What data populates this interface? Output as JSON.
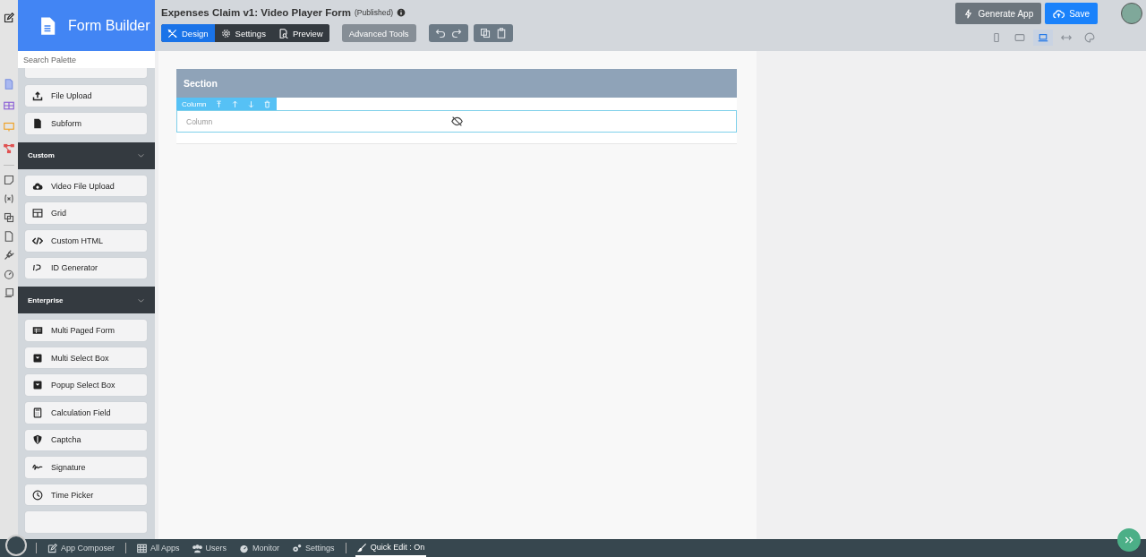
{
  "brand": {
    "title": "Form Builder"
  },
  "palette": {
    "search_placeholder": "Search Palette",
    "top_items": [
      "File Upload",
      "Subform"
    ],
    "groups": [
      {
        "title": "Custom",
        "expanded": true,
        "items": [
          "Video File Upload",
          "Grid",
          "Custom HTML",
          "ID Generator"
        ]
      },
      {
        "title": "Enterprise",
        "expanded": true,
        "items": [
          "Multi Paged Form",
          "Multi Select Box",
          "Popup Select Box",
          "Calculation Field",
          "Captcha",
          "Signature",
          "Time Picker"
        ]
      }
    ]
  },
  "header": {
    "title": "Expenses Claim v1: Video Player Form",
    "status": "(Published)",
    "modes": [
      {
        "label": "Design",
        "selected": true
      },
      {
        "label": "Settings",
        "selected": false
      },
      {
        "label": "Preview",
        "selected": false
      }
    ],
    "advanced": "Advanced Tools",
    "generate": "Generate App",
    "save": "Save",
    "devices": [
      {
        "kind": "phone",
        "selected": false
      },
      {
        "kind": "tablet",
        "selected": false
      },
      {
        "kind": "laptop",
        "selected": true
      },
      {
        "kind": "width",
        "selected": false
      },
      {
        "kind": "palette",
        "selected": false
      }
    ]
  },
  "canvas": {
    "section_title": "Section",
    "column_toolbar": "Column",
    "column_placeholder": "Column"
  },
  "footer": {
    "items": [
      {
        "label": "App Composer",
        "selected": false
      },
      {
        "label": "All Apps",
        "selected": false
      },
      {
        "label": "Users",
        "selected": false
      },
      {
        "label": "Monitor",
        "selected": false
      },
      {
        "label": "Settings",
        "selected": false
      },
      {
        "label": "Quick Edit : On",
        "selected": true
      }
    ]
  }
}
